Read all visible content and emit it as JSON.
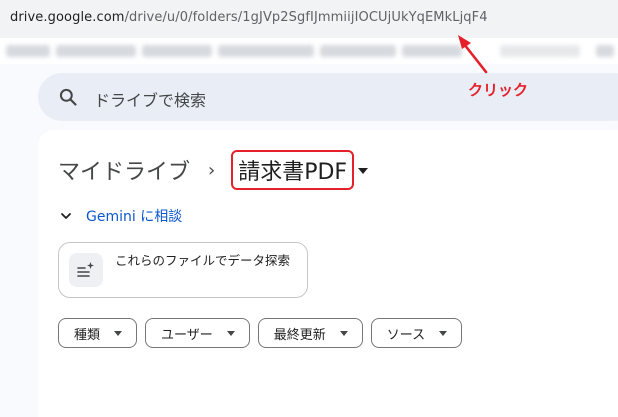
{
  "browser": {
    "url_domain": "drive.google.com",
    "url_path": "/drive/u/0/folders/1gJVp2SgfIJmmiijIOCUjUkYqEMkLjqF4"
  },
  "search": {
    "placeholder": "ドライブで検索",
    "icon": "search-icon"
  },
  "breadcrumb": {
    "root": "マイドライブ",
    "separator": "›",
    "current": "請求書PDF"
  },
  "gemini": {
    "brand": "Gemini",
    "label_suffix": " に相談"
  },
  "explore_chip": {
    "label": "これらのファイルでデータ探索"
  },
  "filters": [
    {
      "label": "種類"
    },
    {
      "label": "ユーザー"
    },
    {
      "label": "最終更新"
    },
    {
      "label": "ソース"
    }
  ],
  "annotation": {
    "label": "クリック",
    "color": "#e6202a"
  },
  "colors": {
    "accent": "#0b57d0",
    "highlight": "#e6202a",
    "search_bg": "#e9eef6"
  }
}
